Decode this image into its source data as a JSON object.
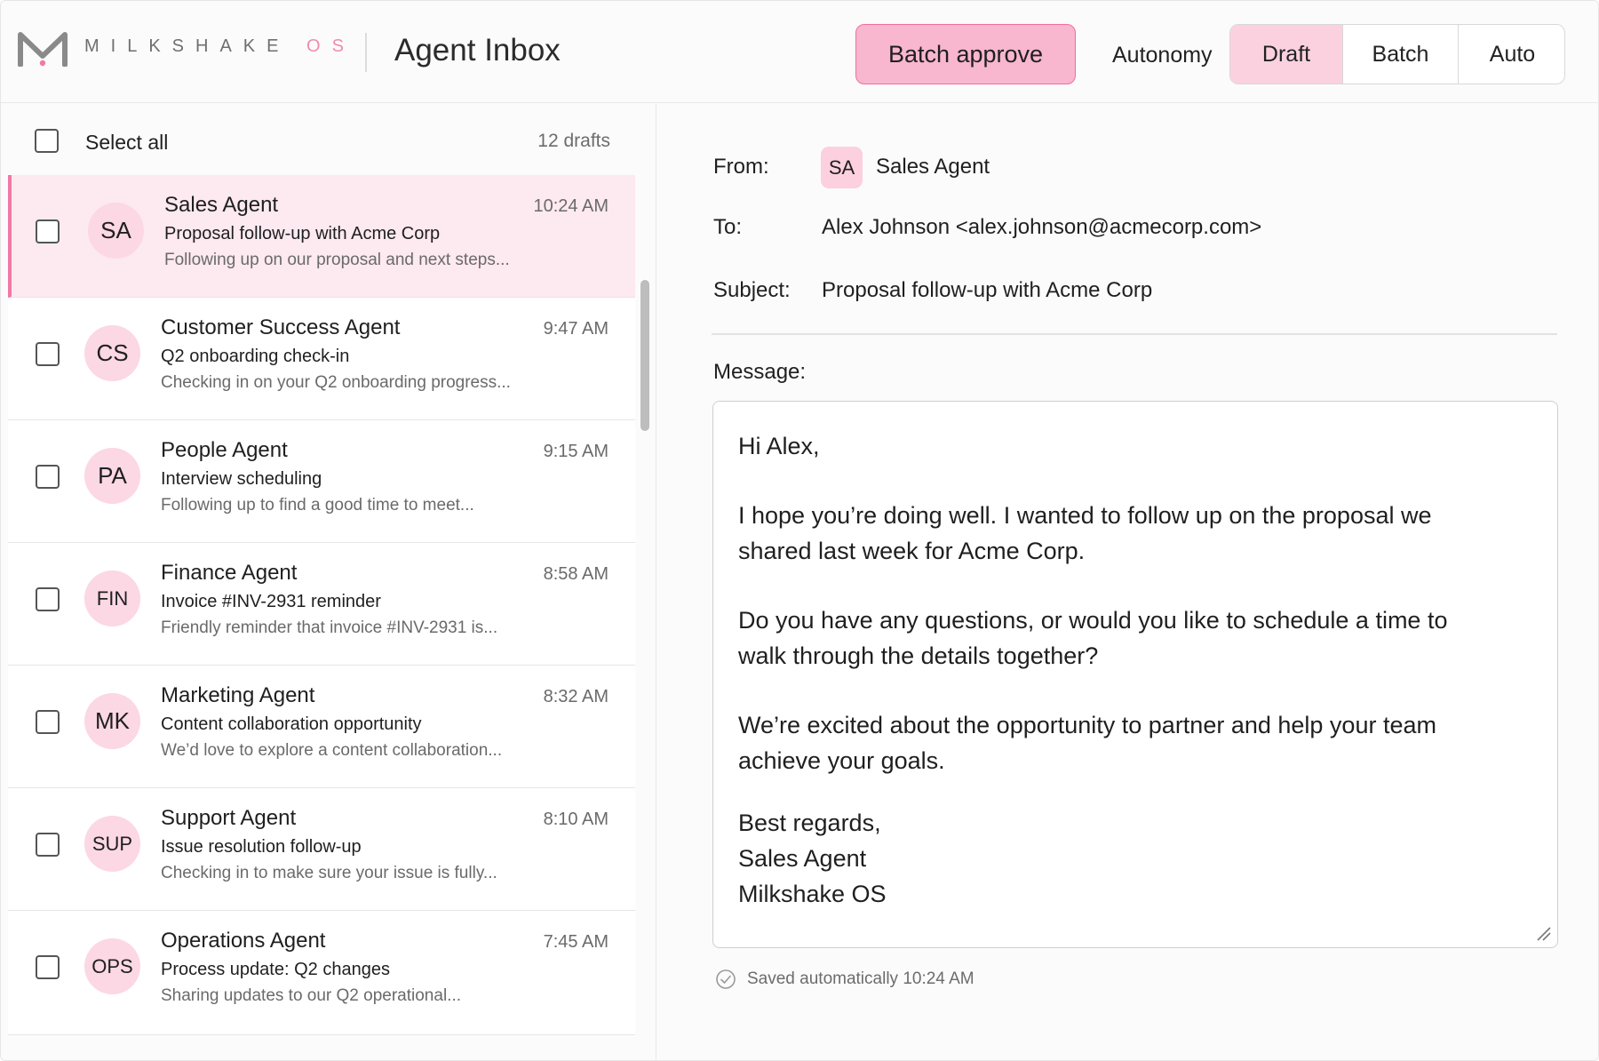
{
  "header": {
    "brand": "MILKSHAKE",
    "brand_suffix": "OS",
    "title": "Agent Inbox",
    "batch_approve_label": "Batch approve",
    "autonomy_label": "Autonomy",
    "modes": [
      "Draft",
      "Batch",
      "Auto"
    ],
    "active_mode": "Draft"
  },
  "list": {
    "select_all_label": "Select all",
    "draft_count": "12 drafts",
    "items": [
      {
        "initials": "SA",
        "sender": "Sales Agent",
        "subject": "Proposal follow-up with Acme Corp",
        "preview": "Following up on our proposal and next steps...",
        "time": "10:24 AM",
        "selected": true
      },
      {
        "initials": "CS",
        "sender": "Customer Success Agent",
        "subject": "Q2 onboarding check-in",
        "preview": "Checking in on your Q2 onboarding progress...",
        "time": "9:47 AM"
      },
      {
        "initials": "PA",
        "sender": "People Agent",
        "subject": "Interview scheduling",
        "preview": "Following up to find a good time to meet...",
        "time": "9:15 AM"
      },
      {
        "initials": "FIN",
        "sender": "Finance Agent",
        "subject": "Invoice #INV-2931 reminder",
        "preview": "Friendly reminder that invoice #INV-2931 is...",
        "time": "8:58 AM"
      },
      {
        "initials": "MK",
        "sender": "Marketing Agent",
        "subject": "Content collaboration opportunity",
        "preview": "We’d love to explore a content collaboration...",
        "time": "8:32 AM"
      },
      {
        "initials": "SUP",
        "sender": "Support Agent",
        "subject": "Issue resolution follow-up",
        "preview": "Checking in to make sure your issue is fully...",
        "time": "8:10 AM"
      },
      {
        "initials": "OPS",
        "sender": "Operations Agent",
        "subject": "Process update: Q2 changes",
        "preview": "Sharing updates to our Q2 operational...",
        "time": "7:45 AM"
      }
    ]
  },
  "detail": {
    "from_label": "From:",
    "from_initials": "SA",
    "from_name": "Sales Agent",
    "to_label": "To:",
    "to_value": "Alex Johnson <alex.johnson@acmecorp.com>",
    "subject_label": "Subject:",
    "subject_value": "Proposal follow-up with Acme Corp",
    "message_label": "Message:",
    "message": {
      "greeting": "Hi Alex,",
      "p1_l1": "I hope you’re doing well. I wanted to follow up on the proposal we",
      "p1_l2": "shared last week for Acme Corp.",
      "p2_l1": "Do you have any questions, or would you like to schedule a time to",
      "p2_l2": "walk through the details together?",
      "p3_l1": "We’re excited about the opportunity to partner and help your team",
      "p3_l2": "achieve your goals.",
      "sign1": "Best regards,",
      "sign2": "Sales Agent",
      "sign3": "Milkshake OS"
    },
    "saved_text": "Saved automatically 10:24 AM"
  },
  "colors": {
    "accent_pink": "#f9b6cf",
    "accent_border": "#f06ea0",
    "selected_row": "#fde9f0",
    "avatar_bg": "#fcd7e4"
  }
}
